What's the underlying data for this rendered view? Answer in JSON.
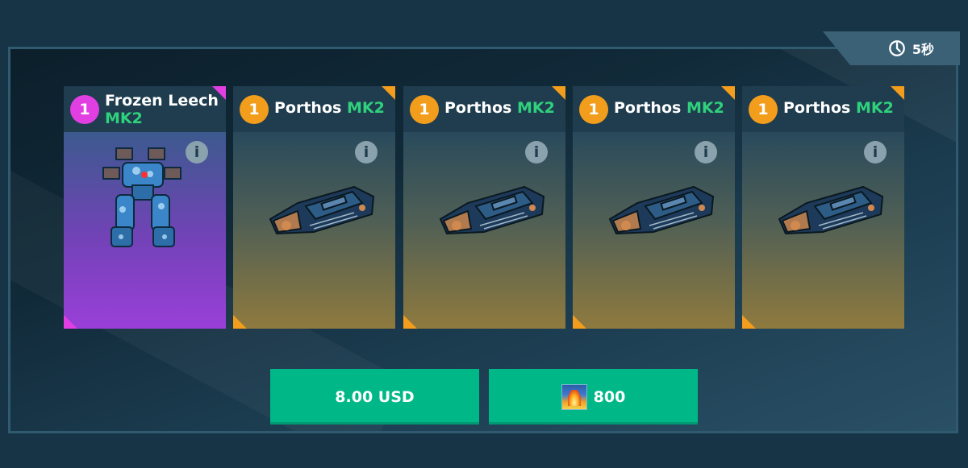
{
  "timer": {
    "label": "5秒",
    "icon": "timer-icon"
  },
  "cards": [
    {
      "level": "1",
      "name": "Frozen Leech",
      "mark": "MK2",
      "rarity": "legendary",
      "rarity_color": "#e23fe2",
      "info_label": "i",
      "item_type": "robot"
    },
    {
      "level": "1",
      "name": "Porthos",
      "mark": "MK2",
      "rarity": "epic",
      "rarity_color": "#f39d1c",
      "info_label": "i",
      "item_type": "weapon"
    },
    {
      "level": "1",
      "name": "Porthos",
      "mark": "MK2",
      "rarity": "epic",
      "rarity_color": "#f39d1c",
      "info_label": "i",
      "item_type": "weapon"
    },
    {
      "level": "1",
      "name": "Porthos",
      "mark": "MK2",
      "rarity": "epic",
      "rarity_color": "#f39d1c",
      "info_label": "i",
      "item_type": "weapon"
    },
    {
      "level": "1",
      "name": "Porthos",
      "mark": "MK2",
      "rarity": "epic",
      "rarity_color": "#f39d1c",
      "info_label": "i",
      "item_type": "weapon"
    }
  ],
  "purchase": {
    "usd_label": "8.00 USD",
    "fuel_label": "800",
    "fuel_icon": "fuel-currency-icon",
    "button_color": "#00b887"
  }
}
